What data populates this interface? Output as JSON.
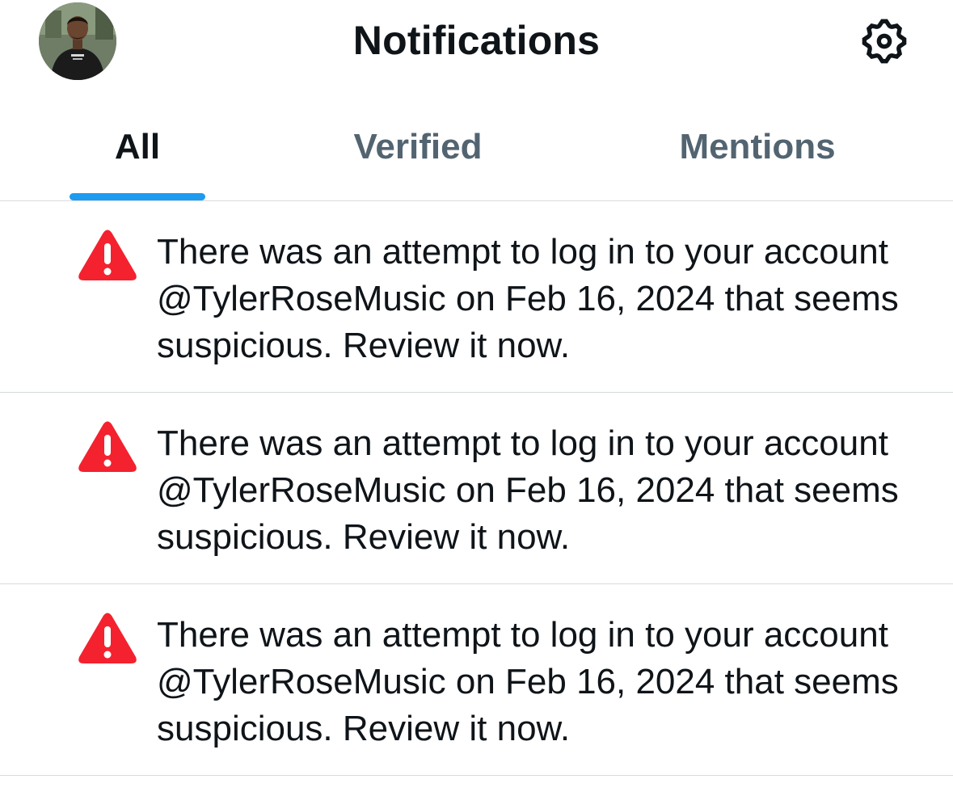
{
  "header": {
    "title": "Notifications",
    "avatar": "profile-avatar",
    "settings_icon": "gear-icon"
  },
  "tabs": [
    {
      "label": "All",
      "active": true
    },
    {
      "label": "Verified",
      "active": false
    },
    {
      "label": "Mentions",
      "active": false
    }
  ],
  "notifications": [
    {
      "icon": "warning-icon",
      "text": "There was an attempt to log in to your account @TylerRoseMusic on Feb 16, 2024 that seems suspicious. Review it now."
    },
    {
      "icon": "warning-icon",
      "text": "There was an attempt to log in to your account @TylerRoseMusic on Feb 16, 2024 that seems suspicious. Review it now."
    },
    {
      "icon": "warning-icon",
      "text": "There was an attempt to log in to your account @TylerRoseMusic on Feb 16, 2024 that seems suspicious. Review it now."
    }
  ],
  "colors": {
    "accent": "#1d9bf0",
    "warning": "#f4212e",
    "text_primary": "#0f1419",
    "text_secondary": "#536471",
    "divider": "#d7dbdc"
  }
}
